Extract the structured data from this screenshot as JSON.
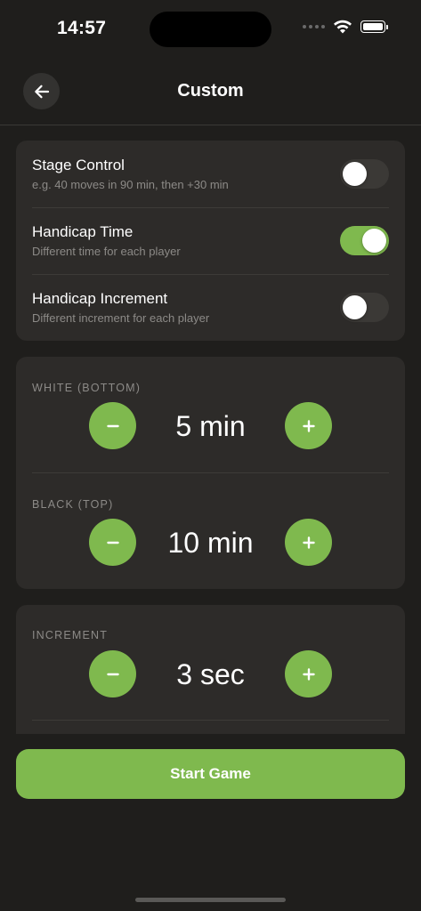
{
  "status_bar": {
    "time": "14:57",
    "icons": [
      "cellular-signal-icon",
      "wifi-icon",
      "battery-icon"
    ]
  },
  "nav": {
    "title": "Custom",
    "back_icon": "arrow-left-icon"
  },
  "options": [
    {
      "title": "Stage Control",
      "subtitle": "e.g. 40 moves in 90 min, then +30 min",
      "enabled": false
    },
    {
      "title": "Handicap Time",
      "subtitle": "Different time for each player",
      "enabled": true
    },
    {
      "title": "Handicap Increment",
      "subtitle": "Different increment for each player",
      "enabled": false
    }
  ],
  "time_card": {
    "white": {
      "label": "WHITE (BOTTOM)",
      "value": "5 min"
    },
    "black": {
      "label": "BLACK (TOP)",
      "value": "10 min"
    }
  },
  "increment_card": {
    "label": "INCREMENT",
    "value": "3 sec"
  },
  "stepper_icons": {
    "decrease": "minus-icon",
    "increase": "plus-icon"
  },
  "start_button": {
    "label": "Start Game"
  },
  "colors": {
    "accent": "#7fb94e",
    "background": "#1f1e1c",
    "card": "#2d2b29",
    "secondary_text": "#8c8a87"
  }
}
